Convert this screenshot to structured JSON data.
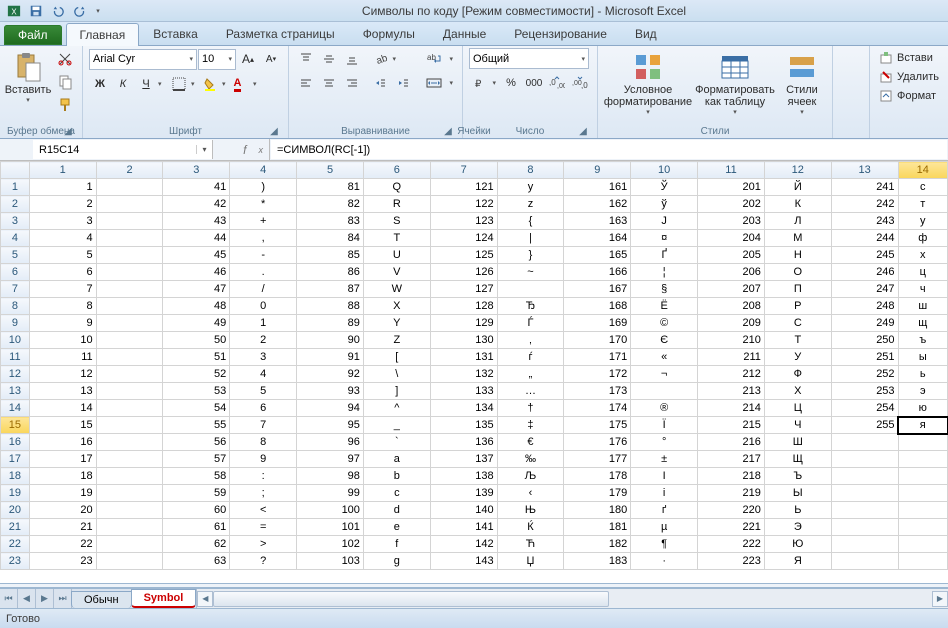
{
  "title": "Символы по коду  [Режим совместимости]  -  Microsoft Excel",
  "tabs": {
    "file": "Файл",
    "home": "Главная",
    "insert": "Вставка",
    "layout": "Разметка страницы",
    "formulas": "Формулы",
    "data": "Данные",
    "review": "Рецензирование",
    "view": "Вид"
  },
  "groups": {
    "clipboard": "Буфер обмена",
    "font": "Шрифт",
    "align": "Выравнивание",
    "number": "Число",
    "styles": "Стили",
    "cells": "Ячейки"
  },
  "paste": "Вставить",
  "font_name": "Arial Cyr",
  "font_size": "10",
  "number_format": "Общий",
  "cond_fmt": "Условное форматирование",
  "fmt_table": "Форматировать как таблицу",
  "cell_styles": "Стили ячеек",
  "right": {
    "insert": "Встави",
    "delete": "Удалить",
    "format": "Формат"
  },
  "name_box": "R15C14",
  "formula": "=СИМВОЛ(RC[-1])",
  "status": "Готово",
  "sheets": {
    "s1": "Обычн",
    "s2": "Symbol"
  },
  "sel": {
    "row": 15,
    "col": 14
  },
  "chart_data": {
    "type": "table",
    "columns": [
      1,
      2,
      3,
      4,
      5,
      6,
      7,
      8,
      9,
      10,
      11,
      12,
      13,
      14
    ],
    "rows": [
      {
        "r": 1,
        "c": [
          1,
          41,
          ")",
          81,
          "Q",
          121,
          "y",
          161,
          "Ў",
          201,
          "Й",
          241,
          "с"
        ]
      },
      {
        "r": 2,
        "c": [
          2,
          42,
          "*",
          82,
          "R",
          122,
          "z",
          162,
          "ў",
          202,
          "К",
          242,
          "т"
        ]
      },
      {
        "r": 3,
        "c": [
          3,
          43,
          "+",
          83,
          "S",
          123,
          "{",
          163,
          "J",
          203,
          "Л",
          243,
          "у"
        ]
      },
      {
        "r": 4,
        "c": [
          4,
          44,
          ",",
          84,
          "T",
          124,
          "|",
          164,
          "¤",
          204,
          "М",
          244,
          "ф"
        ]
      },
      {
        "r": 5,
        "c": [
          5,
          45,
          "-",
          85,
          "U",
          125,
          "}",
          165,
          "Ґ",
          205,
          "Н",
          245,
          "х"
        ]
      },
      {
        "r": 6,
        "c": [
          6,
          46,
          ".",
          86,
          "V",
          126,
          "~",
          166,
          "¦",
          206,
          "О",
          246,
          "ц"
        ]
      },
      {
        "r": 7,
        "c": [
          7,
          47,
          "/",
          87,
          "W",
          127,
          "",
          167,
          "§",
          207,
          "П",
          247,
          "ч"
        ]
      },
      {
        "r": 8,
        "c": [
          8,
          48,
          "0",
          88,
          "X",
          128,
          "Ђ",
          168,
          "Ё",
          208,
          "Р",
          248,
          "ш"
        ]
      },
      {
        "r": 9,
        "c": [
          9,
          49,
          "1",
          89,
          "Y",
          129,
          "Ѓ",
          169,
          "©",
          209,
          "С",
          249,
          "щ"
        ]
      },
      {
        "r": 10,
        "c": [
          10,
          50,
          "2",
          90,
          "Z",
          130,
          "‚",
          170,
          "Є",
          210,
          "Т",
          250,
          "ъ"
        ]
      },
      {
        "r": 11,
        "c": [
          11,
          51,
          "3",
          91,
          "[",
          131,
          "ѓ",
          171,
          "«",
          211,
          "У",
          251,
          "ы"
        ]
      },
      {
        "r": 12,
        "c": [
          12,
          52,
          "4",
          92,
          "\\",
          132,
          "„",
          172,
          "¬",
          212,
          "Ф",
          252,
          "ь"
        ]
      },
      {
        "r": 13,
        "c": [
          13,
          53,
          "5",
          93,
          "]",
          133,
          "…",
          173,
          "­",
          213,
          "Х",
          253,
          "э"
        ]
      },
      {
        "r": 14,
        "c": [
          14,
          54,
          "6",
          94,
          "^",
          134,
          "†",
          174,
          "®",
          214,
          "Ц",
          254,
          "ю"
        ]
      },
      {
        "r": 15,
        "c": [
          15,
          55,
          "7",
          95,
          "_",
          135,
          "‡",
          175,
          "Ї",
          215,
          "Ч",
          255,
          "я"
        ]
      },
      {
        "r": 16,
        "c": [
          16,
          56,
          "8",
          96,
          "`",
          136,
          "€",
          176,
          "°",
          216,
          "Ш",
          "",
          ""
        ]
      },
      {
        "r": 17,
        "c": [
          17,
          57,
          "9",
          97,
          "a",
          137,
          "‰",
          177,
          "±",
          217,
          "Щ",
          "",
          ""
        ]
      },
      {
        "r": 18,
        "c": [
          18,
          58,
          ":",
          98,
          "b",
          138,
          "Љ",
          178,
          "І",
          218,
          "Ъ",
          "",
          ""
        ]
      },
      {
        "r": 19,
        "c": [
          19,
          59,
          ";",
          99,
          "c",
          139,
          "‹",
          179,
          "і",
          219,
          "Ы",
          "",
          ""
        ]
      },
      {
        "r": 20,
        "c": [
          20,
          60,
          "<",
          100,
          "d",
          140,
          "Њ",
          180,
          "ґ",
          220,
          "Ь",
          "",
          ""
        ]
      },
      {
        "r": 21,
        "c": [
          21,
          61,
          "=",
          101,
          "e",
          141,
          "Ќ",
          181,
          "µ",
          221,
          "Э",
          "",
          ""
        ]
      },
      {
        "r": 22,
        "c": [
          22,
          62,
          ">",
          102,
          "f",
          142,
          "Ћ",
          182,
          "¶",
          222,
          "Ю",
          "",
          ""
        ]
      },
      {
        "r": 23,
        "c": [
          23,
          63,
          "?",
          103,
          "g",
          143,
          "Џ",
          183,
          "·",
          223,
          "Я",
          "",
          ""
        ]
      }
    ]
  }
}
